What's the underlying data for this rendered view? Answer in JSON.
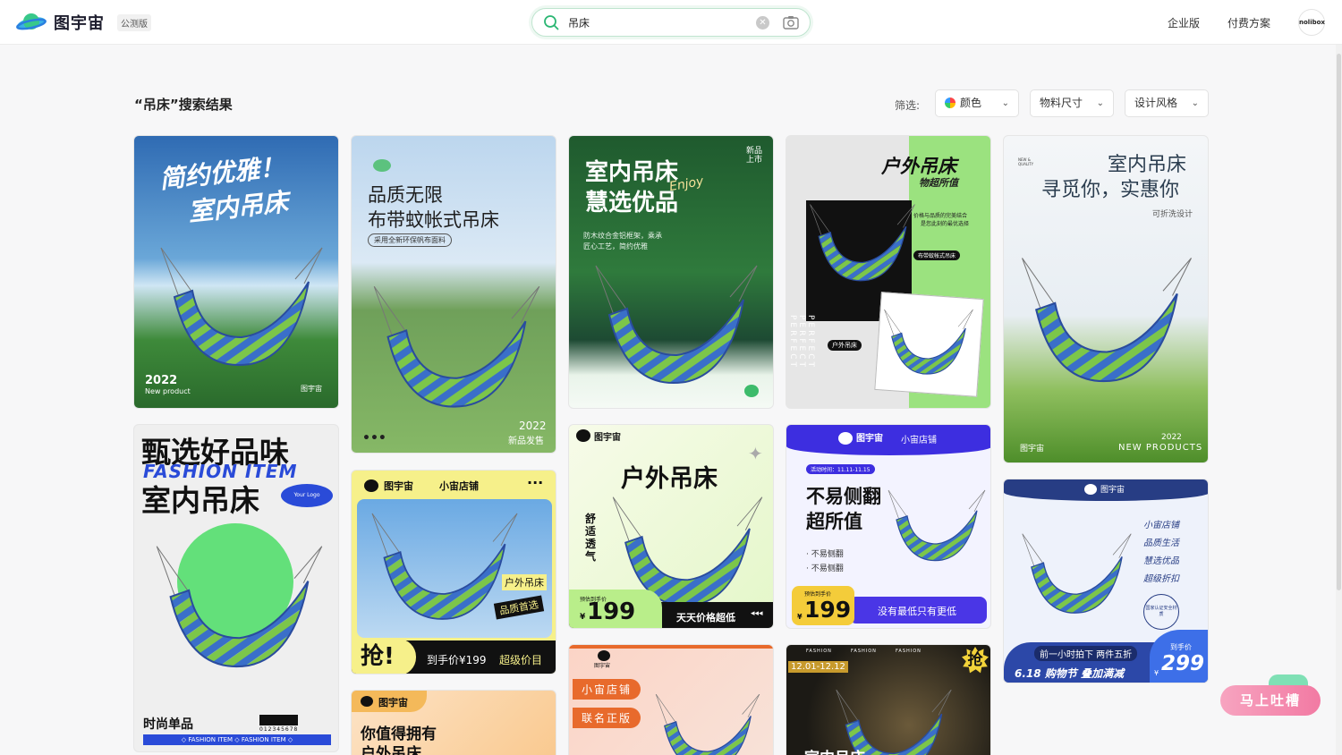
{
  "header": {
    "brand": "图宇宙",
    "beta_badge": "公测版",
    "search": {
      "value": "吊床",
      "placeholder": ""
    },
    "nav": [
      "企业版",
      "付费方案"
    ],
    "avatar_text": "nolibox"
  },
  "results": {
    "title": "“吊床”搜索结果",
    "filter_label": "筛选:",
    "filters": [
      "颜色",
      "物料尺寸",
      "设计风格"
    ]
  },
  "cards": {
    "c1": {
      "line1": "简约优雅！",
      "line2": "室内吊床",
      "year": "2022",
      "sub": "New product",
      "brand": "图宇宙"
    },
    "c2": {
      "line1": "品质无限",
      "line2": "布带蚊帐式吊床",
      "tag": "采用全新环保帆布面料",
      "year": "2022",
      "sub": "新品发售"
    },
    "c3": {
      "line1": "室内吊床",
      "line2": "慧选优品",
      "script": "Enjoy",
      "badge": "新品上市",
      "desc1": "防木纹合金铝框架，乘承",
      "desc2": "匠心工艺，简约优雅"
    },
    "c4": {
      "line1": "户外吊床",
      "line2": "物超所值",
      "desc1": "价格与品质的完美结合",
      "desc2": "是您此刻的最优选择",
      "pill1": "布带蚊帐式吊床",
      "pill2": "户外吊床",
      "side": "PERFECT PERFECT PERFECT"
    },
    "c5": {
      "line1": "室内吊床",
      "line2": "寻觅你，实惠你",
      "sub": "可折洗设计",
      "tiny": "NEW & QUALITY",
      "year": "2022",
      "foot": "NEW PRODUCTS",
      "brand": "图宇宙"
    },
    "c6": {
      "line1": "甄选好品味",
      "line2": "FASHION ITEM",
      "line3": "室内吊床",
      "logo": "Your Logo",
      "foot1": "时尚单品",
      "barcode": "012345678",
      "strip": "◇ FASHION ITEM ◇ FASHION ITEM ◇"
    },
    "c7": {
      "brand": "图宇宙",
      "shop": "小宙店铺",
      "tag1": "户外吊床",
      "tag2": "品质首选",
      "grab": "抢!",
      "price": "到手价¥199",
      "value": "超级价目"
    },
    "c8": {
      "brand": "图宇宙",
      "title": "户外吊床",
      "side": "舒适透气",
      "price_label": "预估到手价",
      "price": "199",
      "currency": "¥",
      "slogan": "天天价格超低"
    },
    "c9": {
      "brand": "图宇宙",
      "shop": "小宙店铺",
      "event": "活动时间：11.11-11.15",
      "line1": "不易侧翻",
      "line2": "超所值",
      "bullet1": "不易侧翻",
      "bullet2": "不易侧翻",
      "price_label": "预估到手价",
      "price": "199",
      "currency": "¥",
      "slogan": "没有最低只有更低"
    },
    "c10": {
      "brand": "图宇宙",
      "items": [
        "小宙店铺",
        "品质生活",
        "慧选优品",
        "超级折扣"
      ],
      "seal": "国家认证安全材质",
      "promo": "前一小时拍下 两件五折",
      "event": "6.18 购物节 叠加满减",
      "price_label": "到手价",
      "price": "299",
      "currency": "¥"
    },
    "c11": {
      "brand": "图宇宙",
      "line1": "你值得拥有",
      "line2": "户外吊床"
    },
    "c12": {
      "brand": "图宇宙",
      "tag1": "小宙店铺",
      "tag2": "联名正版"
    },
    "c13": {
      "fashion": "FASHION",
      "date": "12.01-12.12",
      "grab": "抢",
      "line1": "室内吊床"
    }
  },
  "feedback": {
    "label": "马上吐槽"
  },
  "colors": {
    "accent": "#2bb673",
    "search_border": "#bfe5cf",
    "feedback": "#f27aa3"
  }
}
